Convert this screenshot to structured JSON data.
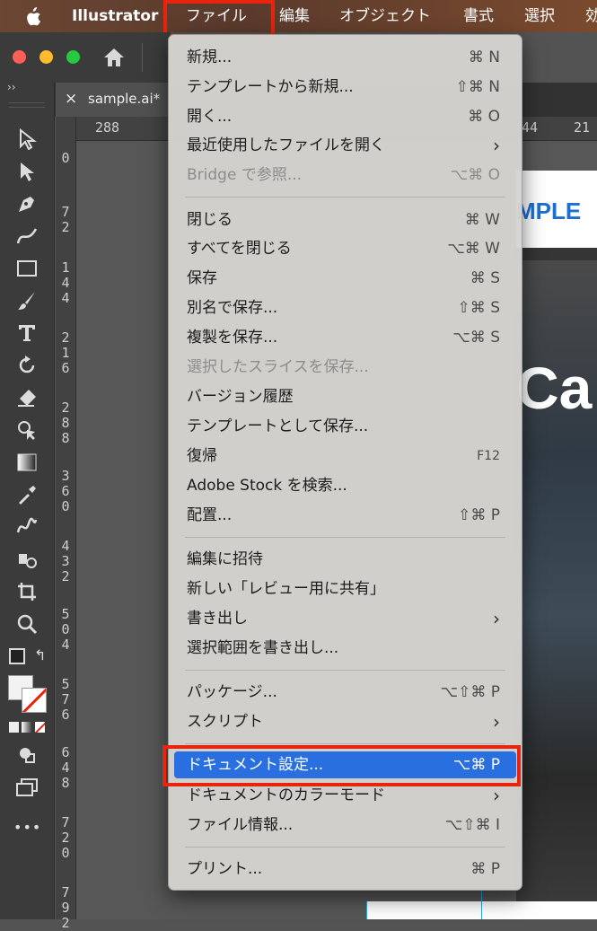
{
  "menubar": {
    "app_name": "Illustrator",
    "items": [
      "ファイル",
      "編集",
      "オブジェクト",
      "書式",
      "選択",
      "効"
    ]
  },
  "tab": {
    "title": "sample.ai*",
    "close": "×"
  },
  "panel_toggle": "››",
  "ruler": {
    "h_ticks": [
      "288",
      "44",
      "21"
    ],
    "v_ticks": [
      "0",
      "72",
      "144",
      "216",
      "288",
      "360",
      "432",
      "504",
      "576",
      "648",
      "720",
      "792"
    ]
  },
  "artwork": {
    "heading_fragment": "MPLE",
    "big_text": "Ca"
  },
  "menu": {
    "items": [
      {
        "label": "新規...",
        "shortcut": "⌘ N"
      },
      {
        "label": "テンプレートから新規...",
        "shortcut": "⇧⌘ N"
      },
      {
        "label": "開く...",
        "shortcut": "⌘ O"
      },
      {
        "label": "最近使用したファイルを開く",
        "submenu": "›"
      },
      {
        "label": "Bridge で参照...",
        "shortcut": "⌥⌘ O",
        "disabled": true
      },
      {
        "label": "閉じる",
        "shortcut": "⌘ W"
      },
      {
        "label": "すべてを閉じる",
        "shortcut": "⌥⌘ W"
      },
      {
        "label": "保存",
        "shortcut": "⌘ S"
      },
      {
        "label": "別名で保存...",
        "shortcut": "⇧⌘ S"
      },
      {
        "label": "複製を保存...",
        "shortcut": "⌥⌘ S"
      },
      {
        "label": "選択したスライスを保存...",
        "disabled": true
      },
      {
        "label": "バージョン履歴"
      },
      {
        "label": "テンプレートとして保存..."
      },
      {
        "label": "復帰",
        "shortcut": "F12"
      },
      {
        "label": "Adobe Stock を検索..."
      },
      {
        "label": "配置...",
        "shortcut": "⇧⌘ P"
      },
      {
        "label": "編集に招待"
      },
      {
        "label": "新しい「レビュー用に共有」"
      },
      {
        "label": "書き出し",
        "submenu": "›"
      },
      {
        "label": "選択範囲を書き出し..."
      },
      {
        "label": "パッケージ...",
        "shortcut": "⌥⇧⌘ P"
      },
      {
        "label": "スクリプト",
        "submenu": "›"
      },
      {
        "label": "ドキュメント設定...",
        "shortcut": "⌥⌘ P",
        "selected": true
      },
      {
        "label": "ドキュメントのカラーモード",
        "submenu": "›"
      },
      {
        "label": "ファイル情報...",
        "shortcut": "⌥⇧⌘ I"
      },
      {
        "label": "プリント...",
        "shortcut": "⌘ P"
      }
    ]
  },
  "tool_more": "•••",
  "colors": {
    "highlight_box": "#e8230e",
    "menu_selection": "#2a6fe0",
    "menubar": "#5a3a2c"
  }
}
